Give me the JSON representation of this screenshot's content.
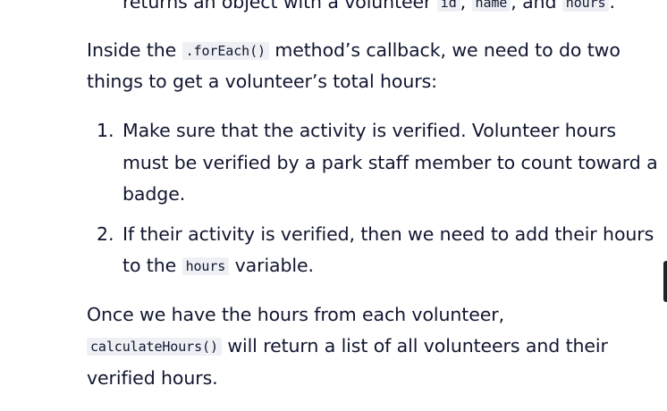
{
  "top_line": {
    "text_before": "returns an object with a volunteer",
    "code1": "id",
    "sep1": ",",
    "code2": "name",
    "sep2": ", and",
    "code3": "hours",
    "end": "."
  },
  "para1": {
    "line1_before": "Inside the",
    "line1_code": ".forEach()",
    "line1_after": "method’s callback, we need to do two",
    "line2": "things to get a volunteer’s total hours:"
  },
  "list": [
    {
      "number": "1.",
      "lines": [
        "Make sure that the activity is verified. Volunteer hours",
        "must be verified by a park staff member to count toward a",
        "badge."
      ]
    },
    {
      "number": "2.",
      "line1": "If their activity is verified, then we need to add their hours",
      "line2_before": "to the",
      "line2_code": "hours",
      "line2_after": "variable."
    }
  ],
  "para2": {
    "line1": "Once we have the hours from each volunteer,",
    "line2_code": "calculateHours()",
    "line2_after": "will return a list of all volunteers and their",
    "line3": "verified hours."
  }
}
